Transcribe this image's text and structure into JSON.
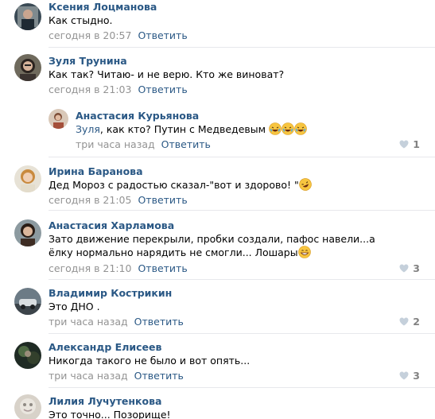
{
  "comments": [
    {
      "author": "Ксения Лоцманова",
      "text": "Как стыдно.",
      "time": "сегодня в 20:57",
      "reply": "Ответить"
    },
    {
      "author": "Зуля Трунина",
      "text": "Как так? Читаю- и не верю. Кто же виноват?",
      "time": "сегодня в 21:03",
      "reply": "Ответить"
    },
    {
      "author": "Анастасия Курьянова",
      "mention": "Зуля",
      "text": ", как кто? Путин с Медведевым ",
      "time": "три часа назад",
      "reply": "Ответить",
      "likes": "1"
    },
    {
      "author": "Ирина Баранова",
      "text": "Дед Мороз с радостью сказал-\"вот и здорово! \"",
      "time": "сегодня в 21:05",
      "reply": "Ответить"
    },
    {
      "author": "Анастасия Харламова",
      "text": "Зато движение перекрыли, пробки создали, пафос навели...а ёлку нормально нарядить не смогли... Лошары",
      "time": "сегодня в 21:10",
      "reply": "Ответить",
      "likes": "3"
    },
    {
      "author": "Владимир Кострикин",
      "text": "Это ДНО .",
      "time": "три часа назад",
      "reply": "Ответить",
      "likes": "2"
    },
    {
      "author": "Александр Елисеев",
      "text": "Никогда такого не было и вот опять...",
      "time": "три часа назад",
      "reply": "Ответить",
      "likes": "3"
    },
    {
      "author": "Лилия Лучутенкова",
      "text": "Это точно... Позорище!"
    }
  ],
  "colors": {
    "link": "#2a5885",
    "meta": "#939393",
    "separator": "#e7e8ec"
  },
  "icons": {
    "like": "heart-icon",
    "emoji_laugh": "laughing-emoji-icon",
    "emoji_rofl": "rofl-emoji-icon",
    "emoji_grin": "grin-emoji-icon"
  }
}
